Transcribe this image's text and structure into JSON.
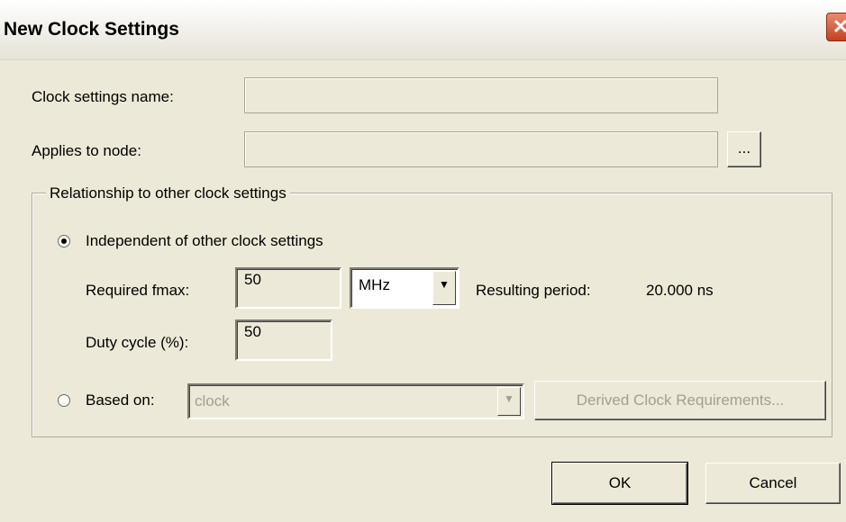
{
  "dialog": {
    "title": "New Clock Settings",
    "close_glyph": "✕"
  },
  "fields": {
    "clock_name_label": "Clock settings name:",
    "clock_name_value": "",
    "applies_label": "Applies to node:",
    "applies_value": "",
    "browse_label": "..."
  },
  "group": {
    "title": "Relationship to other clock settings",
    "independent_label": "Independent of other clock settings",
    "independent_selected": true,
    "fmax_label": "Required fmax:",
    "fmax_value": "50",
    "unit_value": "MHz",
    "resulting_label": "Resulting period:",
    "resulting_value": "20.000 ns",
    "duty_label": "Duty cycle (%):",
    "duty_value": "50",
    "based_on_label": "Based on:",
    "based_on_value": "clock",
    "derived_button": "Derived Clock Requirements..."
  },
  "buttons": {
    "ok": "OK",
    "cancel": "Cancel"
  },
  "colors": {
    "dialog_bg": "#ece9d8",
    "close_red": "#c4401f"
  }
}
